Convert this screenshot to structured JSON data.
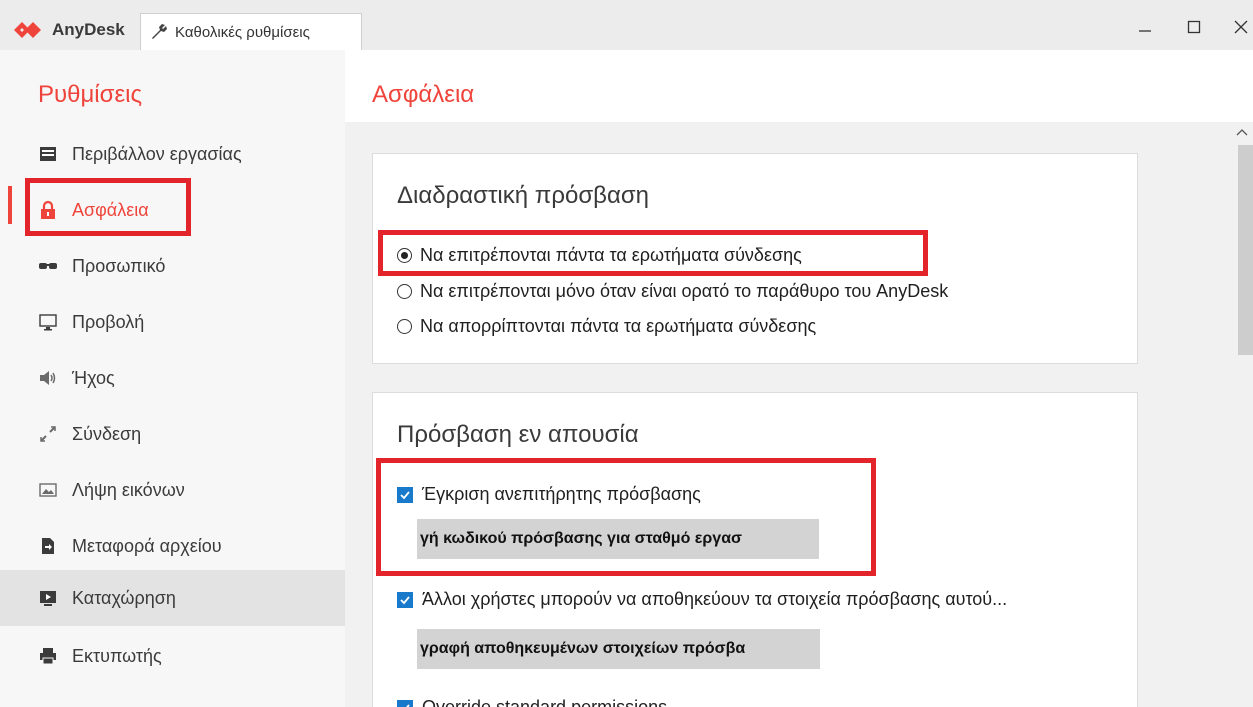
{
  "titlebar": {
    "app_name": "AnyDesk",
    "tab_label": "Καθολικές ρυθμίσεις",
    "brand_color": "#ef443b"
  },
  "sidebar": {
    "title": "Ρυθμίσεις",
    "items": [
      {
        "label": "Περιβάλλον εργασίας",
        "icon": "monitor-lines-icon"
      },
      {
        "label": "Ασφάλεια",
        "icon": "lock-icon"
      },
      {
        "label": "Προσωπικό",
        "icon": "sunglasses-icon"
      },
      {
        "label": "Προβολή",
        "icon": "display-icon"
      },
      {
        "label": "Ήχος",
        "icon": "speaker-icon"
      },
      {
        "label": "Σύνδεση",
        "icon": "connection-icon"
      },
      {
        "label": "Λήψη εικόνων",
        "icon": "image-icon"
      },
      {
        "label": "Μεταφορά αρχείου",
        "icon": "file-transfer-icon"
      },
      {
        "label": "Καταχώρηση",
        "icon": "recording-icon"
      },
      {
        "label": "Εκτυπωτής",
        "icon": "printer-icon"
      }
    ]
  },
  "main": {
    "title": "Ασφάλεια",
    "interactive": {
      "title": "Διαδραστική πρόσβαση",
      "options": [
        "Να επιτρέπονται πάντα τα ερωτήματα σύνδεσης",
        "Να επιτρέπονται μόνο όταν είναι ορατό το παράθυρο του AnyDesk",
        "Να απορρίπτονται πάντα τα ερωτήματα σύνδεσης"
      ],
      "selected_index": 0
    },
    "unattended": {
      "title": "Πρόσβαση εν απουσία",
      "enable_label": "Έγκριση ανεπιτήρητης πρόσβασης",
      "set_password_button": "γή κωδικού πρόσβασης για σταθμό εργασ",
      "others_save_label": "Άλλοι χρήστες μπορούν να αποθηκεύουν τα στοιχεία πρόσβασης αυτού...",
      "clear_saved_button": "γραφή αποθηκευμένων στοιχείων πρόσβα",
      "override_label": "Override standard permissions"
    }
  }
}
